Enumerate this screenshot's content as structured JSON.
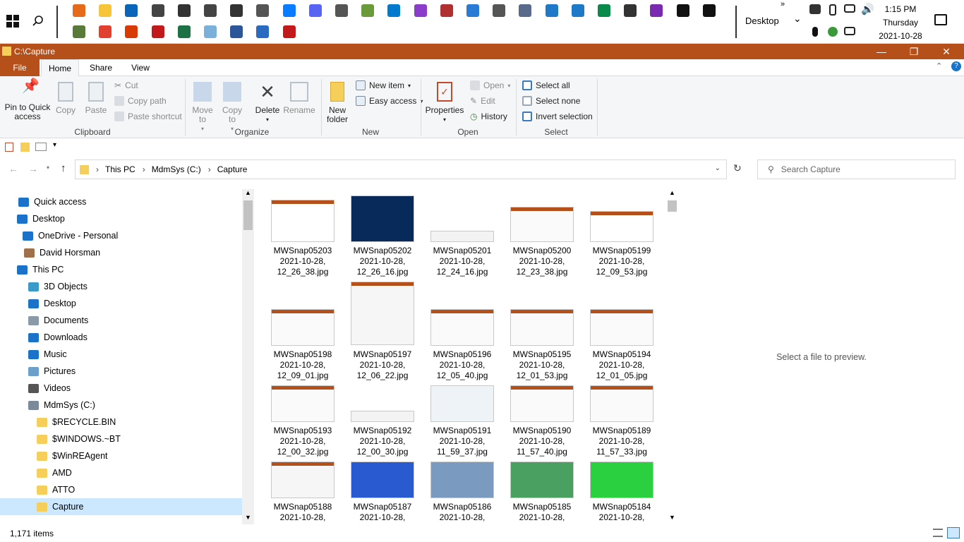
{
  "taskbar": {
    "desktop_label": "Desktop",
    "clock": {
      "time": "1:15 PM",
      "day": "Thursday",
      "date": "2021-10-28"
    },
    "icons_row1": [
      "firefox-icon",
      "file-explorer-icon",
      "outlook-icon",
      "app-icon",
      "app-icon",
      "app-icon",
      "app-icon",
      "app-icon",
      "messenger-icon",
      "discord-icon",
      "app-icon",
      "app-icon",
      "vscode-icon",
      "visual-studio-icon",
      "app-icon",
      "app-icon",
      "settings-icon",
      "app-icon",
      "app-icon",
      "app-icon",
      "app-icon",
      "app-icon",
      "app-icon",
      "terminal-icon",
      "terminal-icon"
    ],
    "icons_row2": [
      "app-icon",
      "chrome-icon",
      "office-icon",
      "acrobat-icon",
      "excel-icon",
      "app-icon",
      "word-icon",
      "app-icon",
      "app-icon"
    ]
  },
  "window": {
    "title": "C:\\Capture",
    "tabs": [
      "File",
      "Home",
      "Share",
      "View"
    ],
    "active_tab": "Home"
  },
  "ribbon": {
    "clipboard": {
      "pin": "Pin to Quick access",
      "copy": "Copy",
      "paste": "Paste",
      "cut": "Cut",
      "copy_path": "Copy path",
      "paste_shortcut": "Paste shortcut",
      "group": "Clipboard"
    },
    "organize": {
      "move_to": "Move to",
      "copy_to": "Copy to",
      "delete": "Delete",
      "rename": "Rename",
      "group": "Organize"
    },
    "new": {
      "new_folder": "New folder",
      "new_item": "New item",
      "easy_access": "Easy access",
      "group": "New"
    },
    "open": {
      "properties": "Properties",
      "open": "Open",
      "edit": "Edit",
      "history": "History",
      "group": "Open"
    },
    "select": {
      "select_all": "Select all",
      "select_none": "Select none",
      "invert": "Invert selection",
      "group": "Select"
    }
  },
  "address": {
    "crumbs": [
      "This PC",
      "MdmSys (C:)",
      "Capture"
    ],
    "search_placeholder": "Search Capture"
  },
  "nav": {
    "items": [
      {
        "label": "Quick access",
        "icon": "star-icon"
      },
      {
        "label": "Desktop",
        "icon": "desktop-icon"
      },
      {
        "label": "OneDrive - Personal",
        "icon": "cloud-icon"
      },
      {
        "label": "David Horsman",
        "icon": "user-icon"
      },
      {
        "label": "This PC",
        "icon": "pc-icon"
      },
      {
        "label": "3D Objects",
        "icon": "cube-icon"
      },
      {
        "label": "Desktop",
        "icon": "desktop-icon"
      },
      {
        "label": "Documents",
        "icon": "document-icon"
      },
      {
        "label": "Downloads",
        "icon": "download-icon"
      },
      {
        "label": "Music",
        "icon": "music-icon"
      },
      {
        "label": "Pictures",
        "icon": "pictures-icon"
      },
      {
        "label": "Videos",
        "icon": "video-icon"
      },
      {
        "label": "MdmSys (C:)",
        "icon": "drive-icon"
      },
      {
        "label": "$RECYCLE.BIN",
        "icon": "folder-icon"
      },
      {
        "label": "$WINDOWS.~BT",
        "icon": "folder-icon"
      },
      {
        "label": "$WinREAgent",
        "icon": "folder-icon"
      },
      {
        "label": "AMD",
        "icon": "folder-icon"
      },
      {
        "label": "ATTO",
        "icon": "folder-icon"
      },
      {
        "label": "Capture",
        "icon": "folder-icon"
      }
    ]
  },
  "files": [
    {
      "name": "MWSnap05203",
      "date": "2021-10-28,",
      "time": "12_26_38.jpg"
    },
    {
      "name": "MWSnap05202",
      "date": "2021-10-28,",
      "time": "12_26_16.jpg"
    },
    {
      "name": "MWSnap05201",
      "date": "2021-10-28,",
      "time": "12_24_16.jpg"
    },
    {
      "name": "MWSnap05200",
      "date": "2021-10-28,",
      "time": "12_23_38.jpg"
    },
    {
      "name": "MWSnap05199",
      "date": "2021-10-28,",
      "time": "12_09_53.jpg"
    },
    {
      "name": "MWSnap05198",
      "date": "2021-10-28,",
      "time": "12_09_01.jpg"
    },
    {
      "name": "MWSnap05197",
      "date": "2021-10-28,",
      "time": "12_06_22.jpg"
    },
    {
      "name": "MWSnap05196",
      "date": "2021-10-28,",
      "time": "12_05_40.jpg"
    },
    {
      "name": "MWSnap05195",
      "date": "2021-10-28,",
      "time": "12_01_53.jpg"
    },
    {
      "name": "MWSnap05194",
      "date": "2021-10-28,",
      "time": "12_01_05.jpg"
    },
    {
      "name": "MWSnap05193",
      "date": "2021-10-28,",
      "time": "12_00_32.jpg"
    },
    {
      "name": "MWSnap05192",
      "date": "2021-10-28,",
      "time": "12_00_30.jpg"
    },
    {
      "name": "MWSnap05191",
      "date": "2021-10-28,",
      "time": "11_59_37.jpg"
    },
    {
      "name": "MWSnap05190",
      "date": "2021-10-28,",
      "time": "11_57_40.jpg"
    },
    {
      "name": "MWSnap05189",
      "date": "2021-10-28,",
      "time": "11_57_33.jpg"
    },
    {
      "name": "MWSnap05188",
      "date": "2021-10-28,",
      "time": ""
    },
    {
      "name": "MWSnap05187",
      "date": "2021-10-28,",
      "time": ""
    },
    {
      "name": "MWSnap05186",
      "date": "2021-10-28,",
      "time": ""
    },
    {
      "name": "MWSnap05185",
      "date": "2021-10-28,",
      "time": ""
    },
    {
      "name": "MWSnap05184",
      "date": "2021-10-28,",
      "time": ""
    }
  ],
  "preview_text": "Select a file to preview.",
  "status": {
    "count": "1,171 items"
  },
  "colors": {
    "titlebar": "#b5501a",
    "selection": "#cce8ff",
    "file_tab": "#b5501a"
  }
}
